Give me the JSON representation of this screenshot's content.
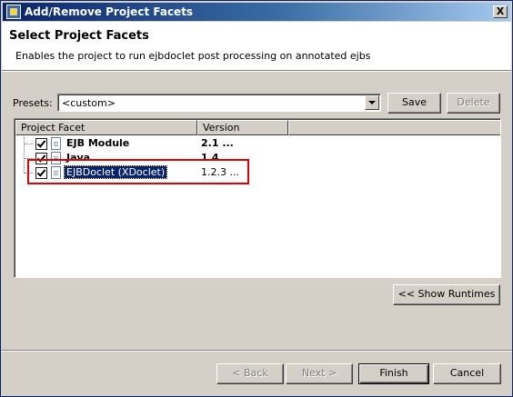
{
  "window": {
    "title": "Add/Remove Project Facets",
    "close_label": "X"
  },
  "banner": {
    "title": "Select Project Facets",
    "description": "Enables the project to run ejbdoclet post processing on annotated ejbs"
  },
  "presets": {
    "label": "Presets:",
    "value": "<custom>",
    "save_label": "Save",
    "delete_label": "Delete"
  },
  "table": {
    "columns": [
      "Project Facet",
      "Version"
    ],
    "rows": [
      {
        "name": "EJB Module",
        "version": "2.1 ...",
        "checked": true
      },
      {
        "name": "Java",
        "version": "1.4 ...",
        "checked": true
      },
      {
        "name": "EJBDoclet (XDoclet)",
        "version": "1.2.3 ...",
        "checked": true
      }
    ]
  },
  "show_runtimes_label": "<< Show Runtimes",
  "footer": {
    "back_label": "< Back",
    "next_label": "Next >",
    "finish_label": "Finish",
    "cancel_label": "Cancel"
  },
  "colors": {
    "title_bar": "#0a246a",
    "dialog_face": "#d4d0c8",
    "selection": "#0a246a",
    "highlight_box": "#e00000"
  }
}
